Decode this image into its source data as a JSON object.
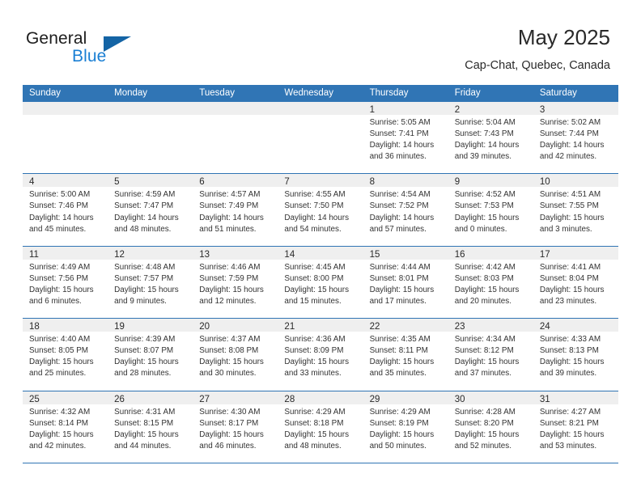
{
  "brand": {
    "word1": "General",
    "word2": "Blue",
    "flag_icon": "brand-flag-icon"
  },
  "header": {
    "title": "May 2025",
    "subtitle": "Cap-Chat, Quebec, Canada"
  },
  "calendar": {
    "accent_color": "#3075b5",
    "daynum_band_color": "#efefef",
    "weekdays": [
      "Sunday",
      "Monday",
      "Tuesday",
      "Wednesday",
      "Thursday",
      "Friday",
      "Saturday"
    ],
    "weeks": [
      [
        {
          "day": "",
          "lines": []
        },
        {
          "day": "",
          "lines": []
        },
        {
          "day": "",
          "lines": []
        },
        {
          "day": "",
          "lines": []
        },
        {
          "day": "1",
          "lines": [
            "Sunrise: 5:05 AM",
            "Sunset: 7:41 PM",
            "Daylight: 14 hours",
            "and 36 minutes."
          ]
        },
        {
          "day": "2",
          "lines": [
            "Sunrise: 5:04 AM",
            "Sunset: 7:43 PM",
            "Daylight: 14 hours",
            "and 39 minutes."
          ]
        },
        {
          "day": "3",
          "lines": [
            "Sunrise: 5:02 AM",
            "Sunset: 7:44 PM",
            "Daylight: 14 hours",
            "and 42 minutes."
          ]
        }
      ],
      [
        {
          "day": "4",
          "lines": [
            "Sunrise: 5:00 AM",
            "Sunset: 7:46 PM",
            "Daylight: 14 hours",
            "and 45 minutes."
          ]
        },
        {
          "day": "5",
          "lines": [
            "Sunrise: 4:59 AM",
            "Sunset: 7:47 PM",
            "Daylight: 14 hours",
            "and 48 minutes."
          ]
        },
        {
          "day": "6",
          "lines": [
            "Sunrise: 4:57 AM",
            "Sunset: 7:49 PM",
            "Daylight: 14 hours",
            "and 51 minutes."
          ]
        },
        {
          "day": "7",
          "lines": [
            "Sunrise: 4:55 AM",
            "Sunset: 7:50 PM",
            "Daylight: 14 hours",
            "and 54 minutes."
          ]
        },
        {
          "day": "8",
          "lines": [
            "Sunrise: 4:54 AM",
            "Sunset: 7:52 PM",
            "Daylight: 14 hours",
            "and 57 minutes."
          ]
        },
        {
          "day": "9",
          "lines": [
            "Sunrise: 4:52 AM",
            "Sunset: 7:53 PM",
            "Daylight: 15 hours",
            "and 0 minutes."
          ]
        },
        {
          "day": "10",
          "lines": [
            "Sunrise: 4:51 AM",
            "Sunset: 7:55 PM",
            "Daylight: 15 hours",
            "and 3 minutes."
          ]
        }
      ],
      [
        {
          "day": "11",
          "lines": [
            "Sunrise: 4:49 AM",
            "Sunset: 7:56 PM",
            "Daylight: 15 hours",
            "and 6 minutes."
          ]
        },
        {
          "day": "12",
          "lines": [
            "Sunrise: 4:48 AM",
            "Sunset: 7:57 PM",
            "Daylight: 15 hours",
            "and 9 minutes."
          ]
        },
        {
          "day": "13",
          "lines": [
            "Sunrise: 4:46 AM",
            "Sunset: 7:59 PM",
            "Daylight: 15 hours",
            "and 12 minutes."
          ]
        },
        {
          "day": "14",
          "lines": [
            "Sunrise: 4:45 AM",
            "Sunset: 8:00 PM",
            "Daylight: 15 hours",
            "and 15 minutes."
          ]
        },
        {
          "day": "15",
          "lines": [
            "Sunrise: 4:44 AM",
            "Sunset: 8:01 PM",
            "Daylight: 15 hours",
            "and 17 minutes."
          ]
        },
        {
          "day": "16",
          "lines": [
            "Sunrise: 4:42 AM",
            "Sunset: 8:03 PM",
            "Daylight: 15 hours",
            "and 20 minutes."
          ]
        },
        {
          "day": "17",
          "lines": [
            "Sunrise: 4:41 AM",
            "Sunset: 8:04 PM",
            "Daylight: 15 hours",
            "and 23 minutes."
          ]
        }
      ],
      [
        {
          "day": "18",
          "lines": [
            "Sunrise: 4:40 AM",
            "Sunset: 8:05 PM",
            "Daylight: 15 hours",
            "and 25 minutes."
          ]
        },
        {
          "day": "19",
          "lines": [
            "Sunrise: 4:39 AM",
            "Sunset: 8:07 PM",
            "Daylight: 15 hours",
            "and 28 minutes."
          ]
        },
        {
          "day": "20",
          "lines": [
            "Sunrise: 4:37 AM",
            "Sunset: 8:08 PM",
            "Daylight: 15 hours",
            "and 30 minutes."
          ]
        },
        {
          "day": "21",
          "lines": [
            "Sunrise: 4:36 AM",
            "Sunset: 8:09 PM",
            "Daylight: 15 hours",
            "and 33 minutes."
          ]
        },
        {
          "day": "22",
          "lines": [
            "Sunrise: 4:35 AM",
            "Sunset: 8:11 PM",
            "Daylight: 15 hours",
            "and 35 minutes."
          ]
        },
        {
          "day": "23",
          "lines": [
            "Sunrise: 4:34 AM",
            "Sunset: 8:12 PM",
            "Daylight: 15 hours",
            "and 37 minutes."
          ]
        },
        {
          "day": "24",
          "lines": [
            "Sunrise: 4:33 AM",
            "Sunset: 8:13 PM",
            "Daylight: 15 hours",
            "and 39 minutes."
          ]
        }
      ],
      [
        {
          "day": "25",
          "lines": [
            "Sunrise: 4:32 AM",
            "Sunset: 8:14 PM",
            "Daylight: 15 hours",
            "and 42 minutes."
          ]
        },
        {
          "day": "26",
          "lines": [
            "Sunrise: 4:31 AM",
            "Sunset: 8:15 PM",
            "Daylight: 15 hours",
            "and 44 minutes."
          ]
        },
        {
          "day": "27",
          "lines": [
            "Sunrise: 4:30 AM",
            "Sunset: 8:17 PM",
            "Daylight: 15 hours",
            "and 46 minutes."
          ]
        },
        {
          "day": "28",
          "lines": [
            "Sunrise: 4:29 AM",
            "Sunset: 8:18 PM",
            "Daylight: 15 hours",
            "and 48 minutes."
          ]
        },
        {
          "day": "29",
          "lines": [
            "Sunrise: 4:29 AM",
            "Sunset: 8:19 PM",
            "Daylight: 15 hours",
            "and 50 minutes."
          ]
        },
        {
          "day": "30",
          "lines": [
            "Sunrise: 4:28 AM",
            "Sunset: 8:20 PM",
            "Daylight: 15 hours",
            "and 52 minutes."
          ]
        },
        {
          "day": "31",
          "lines": [
            "Sunrise: 4:27 AM",
            "Sunset: 8:21 PM",
            "Daylight: 15 hours",
            "and 53 minutes."
          ]
        }
      ]
    ]
  }
}
